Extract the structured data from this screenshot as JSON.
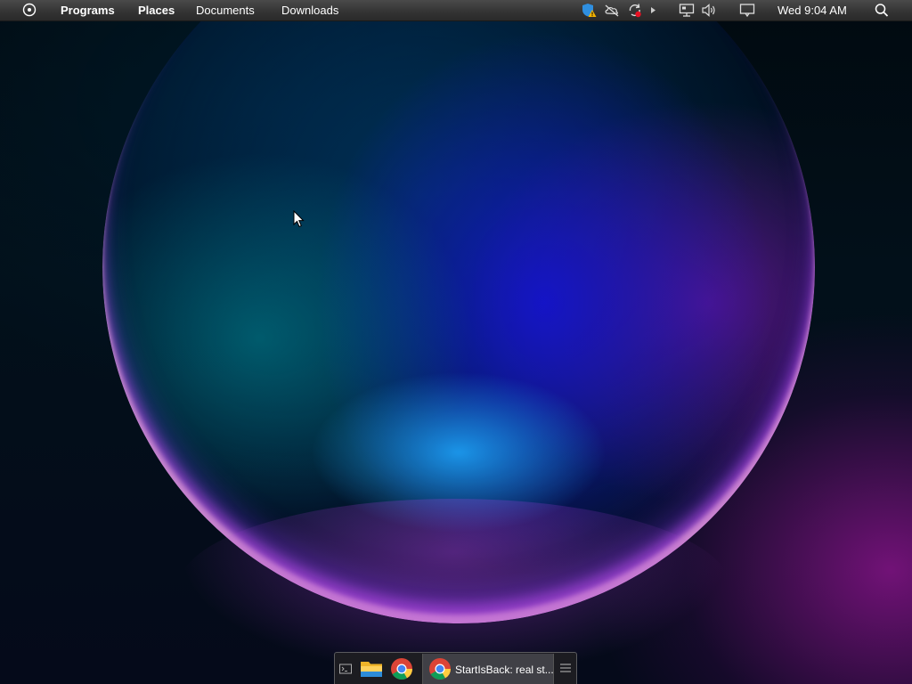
{
  "menubar": {
    "programs_label": "Programs",
    "places_label": "Places",
    "documents_label": "Documents",
    "downloads_label": "Downloads",
    "clock": "Wed 9:04 AM",
    "tray_icons": [
      "defender-warning-icon",
      "onedrive-off-icon",
      "sync-error-icon",
      "tray-expand-icon",
      "network-icon",
      "volume-icon",
      "notifications-icon",
      "search-icon"
    ]
  },
  "taskbar": {
    "pinned": [
      "terminal-icon",
      "file-explorer-icon",
      "chrome-icon"
    ],
    "active_window": {
      "icon": "chrome-icon",
      "title": "StartIsBack: real st..."
    },
    "menu_icon": "taskbar-menu-icon"
  },
  "colors": {
    "menubar_bg": "#333333",
    "taskbar_bg": "#1e1e22",
    "accent_red": "#e81123",
    "accent_warning": "#f5b400"
  }
}
